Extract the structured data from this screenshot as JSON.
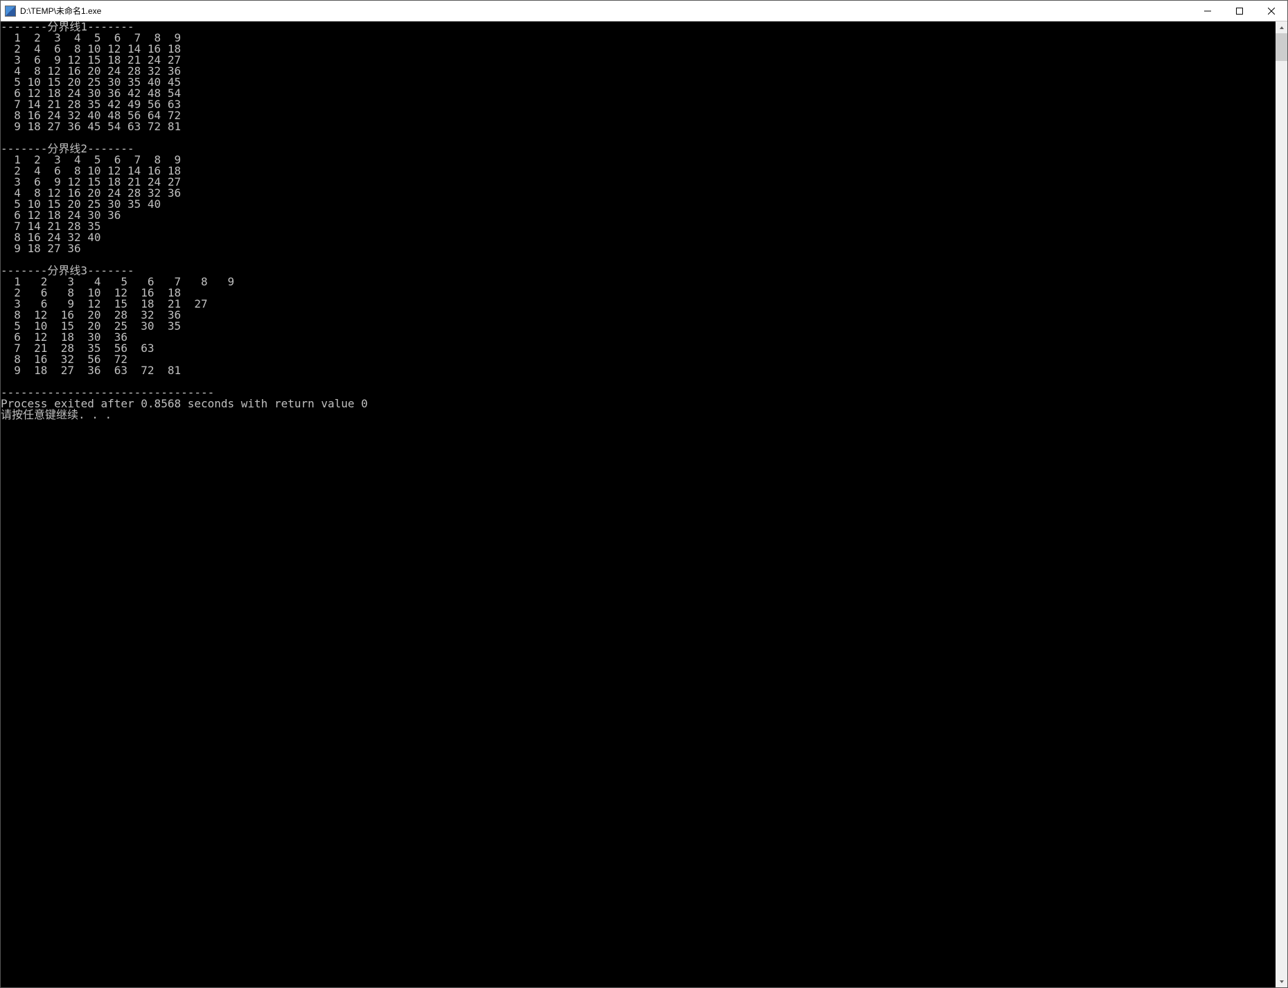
{
  "window": {
    "title": "D:\\TEMP\\未命名1.exe"
  },
  "console": {
    "section1_header": "-------分界线1-------",
    "section1_lines": [
      "  1  2  3  4  5  6  7  8  9",
      "  2  4  6  8 10 12 14 16 18",
      "  3  6  9 12 15 18 21 24 27",
      "  4  8 12 16 20 24 28 32 36",
      "  5 10 15 20 25 30 35 40 45",
      "  6 12 18 24 30 36 42 48 54",
      "  7 14 21 28 35 42 49 56 63",
      "  8 16 24 32 40 48 56 64 72",
      "  9 18 27 36 45 54 63 72 81"
    ],
    "section2_header": "-------分界线2-------",
    "section2_lines": [
      "  1  2  3  4  5  6  7  8  9",
      "  2  4  6  8 10 12 14 16 18",
      "  3  6  9 12 15 18 21 24 27",
      "  4  8 12 16 20 24 28 32 36",
      "  5 10 15 20 25 30 35 40",
      "  6 12 18 24 30 36",
      "  7 14 21 28 35",
      "  8 16 24 32 40",
      "  9 18 27 36"
    ],
    "section3_header": "-------分界线3-------",
    "section3_lines": [
      "  1   2   3   4   5   6   7   8   9",
      "  2   6   8  10  12  16  18",
      "  3   6   9  12  15  18  21  27",
      "  8  12  16  20  28  32  36",
      "  5  10  15  20  25  30  35",
      "  6  12  18  30  36",
      "  7  21  28  35  56  63",
      "  8  16  32  56  72",
      "  9  18  27  36  63  72  81"
    ],
    "footer_divider": "--------------------------------",
    "exit_message": "Process exited after 0.8568 seconds with return value 0",
    "press_key": "请按任意键继续. . ."
  },
  "chart_data": {
    "type": "table",
    "title": "Multiplication table output (three variants)",
    "tables": [
      {
        "label": "分界线1",
        "rows": [
          [
            1,
            2,
            3,
            4,
            5,
            6,
            7,
            8,
            9
          ],
          [
            2,
            4,
            6,
            8,
            10,
            12,
            14,
            16,
            18
          ],
          [
            3,
            6,
            9,
            12,
            15,
            18,
            21,
            24,
            27
          ],
          [
            4,
            8,
            12,
            16,
            20,
            24,
            28,
            32,
            36
          ],
          [
            5,
            10,
            15,
            20,
            25,
            30,
            35,
            40,
            45
          ],
          [
            6,
            12,
            18,
            24,
            30,
            36,
            42,
            48,
            54
          ],
          [
            7,
            14,
            21,
            28,
            35,
            42,
            49,
            56,
            63
          ],
          [
            8,
            16,
            24,
            32,
            40,
            48,
            56,
            64,
            72
          ],
          [
            9,
            18,
            27,
            36,
            45,
            54,
            63,
            72,
            81
          ]
        ]
      },
      {
        "label": "分界线2",
        "rows": [
          [
            1,
            2,
            3,
            4,
            5,
            6,
            7,
            8,
            9
          ],
          [
            2,
            4,
            6,
            8,
            10,
            12,
            14,
            16,
            18
          ],
          [
            3,
            6,
            9,
            12,
            15,
            18,
            21,
            24,
            27
          ],
          [
            4,
            8,
            12,
            16,
            20,
            24,
            28,
            32,
            36
          ],
          [
            5,
            10,
            15,
            20,
            25,
            30,
            35,
            40
          ],
          [
            6,
            12,
            18,
            24,
            30,
            36
          ],
          [
            7,
            14,
            21,
            28,
            35
          ],
          [
            8,
            16,
            24,
            32,
            40
          ],
          [
            9,
            18,
            27,
            36
          ]
        ]
      },
      {
        "label": "分界线3",
        "rows": [
          [
            1,
            2,
            3,
            4,
            5,
            6,
            7,
            8,
            9
          ],
          [
            2,
            6,
            8,
            10,
            12,
            16,
            18
          ],
          [
            3,
            6,
            9,
            12,
            15,
            18,
            21,
            27
          ],
          [
            8,
            12,
            16,
            20,
            28,
            32,
            36
          ],
          [
            5,
            10,
            15,
            20,
            25,
            30,
            35
          ],
          [
            6,
            12,
            18,
            30,
            36
          ],
          [
            7,
            21,
            28,
            35,
            56,
            63
          ],
          [
            8,
            16,
            32,
            56,
            72
          ],
          [
            9,
            18,
            27,
            36,
            63,
            72,
            81
          ]
        ]
      }
    ]
  }
}
